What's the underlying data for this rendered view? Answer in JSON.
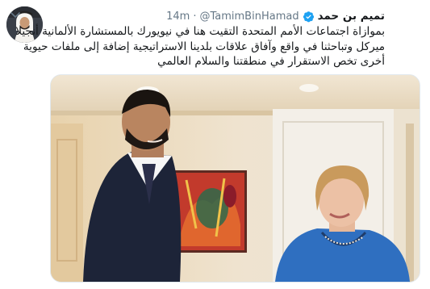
{
  "tweet": {
    "author_name": "تميم بن حمد",
    "handle": "@TamimBinHamad",
    "separator": "·",
    "time": "14m",
    "text_lines": [
      "بموازاة اجتماعات الأمم المتحدة التقيت هنا في نيويورك بالمستشارة الألمانية أنجيلا",
      "ميركل وتباحثنا في واقع وآفاق علاقات بلدينا الاستراتيجية إضافة إلى ملفات حيوية",
      "أخرى تخص الاستقرار في منطقتنا والسلام العالمي"
    ],
    "icons": {
      "verified": "verified-badge-icon",
      "caret": "chevron-down-icon"
    }
  },
  "colors": {
    "verified": "#1da1f2",
    "handle": "#657786",
    "text": "#14171a"
  }
}
